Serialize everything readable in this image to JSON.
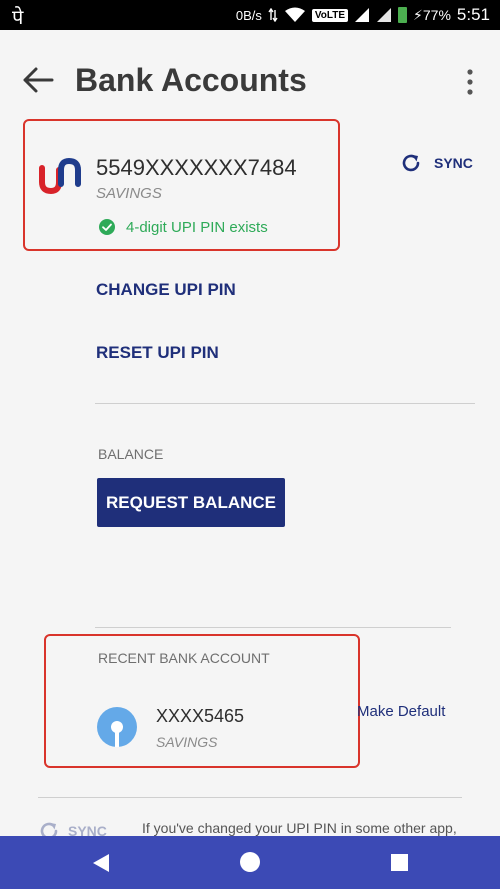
{
  "status_bar": {
    "app_glyph": "पे",
    "net_speed": "0B/s",
    "volte": "VoLTE",
    "battery": "⚡77%",
    "time": "5:51"
  },
  "header": {
    "title": "Bank Accounts"
  },
  "primary_account": {
    "number": "5549XXXXXXX7484",
    "type": "SAVINGS",
    "pin_status": "4-digit UPI PIN exists",
    "sync_label": "SYNC"
  },
  "actions": {
    "change_pin": "CHANGE UPI PIN",
    "reset_pin": "RESET UPI PIN"
  },
  "balance": {
    "label": "BALANCE",
    "button": "REQUEST BALANCE"
  },
  "recent": {
    "label": "RECENT BANK ACCOUNT",
    "number": "XXXX5465",
    "type": "SAVINGS",
    "make_default": "Make Default"
  },
  "footer": {
    "sync_label": "SYNC",
    "info": "If you've changed your UPI PIN in some other app,"
  },
  "colors": {
    "accent": "#1f2f7a",
    "success": "#2eaa58",
    "highlight": "#d9342b",
    "navbar": "#3c4ab5"
  }
}
